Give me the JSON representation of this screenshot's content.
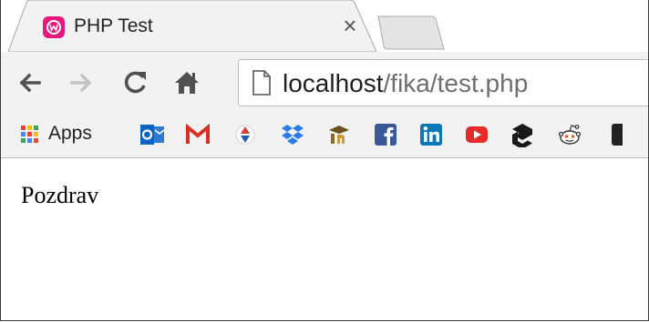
{
  "tab": {
    "title": "PHP Test",
    "close_glyph": "×",
    "favicon": "wampserver-icon"
  },
  "toolbar": {
    "back_icon": "arrow-left-icon",
    "forward_icon": "arrow-right-icon",
    "reload_icon": "reload-icon",
    "home_icon": "home-icon",
    "page_icon": "page-icon",
    "url_host": "localhost",
    "url_path": "/fika/test.php"
  },
  "bookmarks": {
    "apps_label": "Apps",
    "items": [
      "outlook-icon",
      "gmail-icon",
      "red-blue-bookmark-icon",
      "dropbox-icon",
      "scholar-icon",
      "facebook-icon",
      "linkedin-icon",
      "youtube-icon",
      "nine-gag-icon",
      "reddit-icon"
    ]
  },
  "page": {
    "body_text": "Pozdrav"
  },
  "colors": {
    "toolbar_bg": "#f2f2f2",
    "favicon_pink": "#e6187d",
    "gmail_red": "#d93025",
    "dropbox_blue": "#2b7de9",
    "facebook_blue": "#3b5998",
    "linkedin_blue": "#0a78b5",
    "youtube_red": "#e52d27"
  }
}
